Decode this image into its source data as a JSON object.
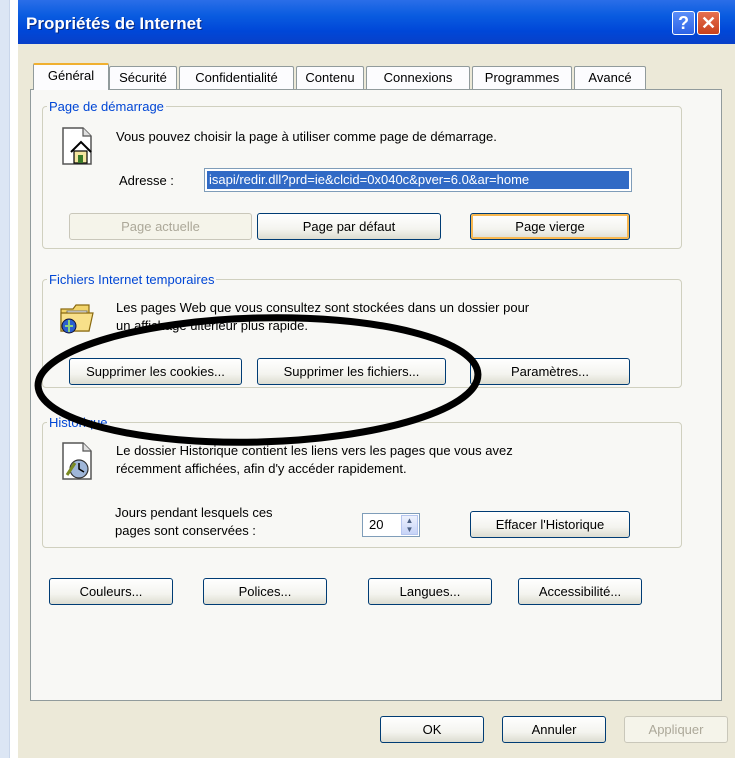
{
  "window": {
    "title": "Propriétés de Internet",
    "help_glyph": "?",
    "close_glyph": "✕"
  },
  "tabs": [
    {
      "label": "Général"
    },
    {
      "label": "Sécurité"
    },
    {
      "label": "Confidentialité"
    },
    {
      "label": "Contenu"
    },
    {
      "label": "Connexions"
    },
    {
      "label": "Programmes"
    },
    {
      "label": "Avancé"
    }
  ],
  "home": {
    "legend": "Page de démarrage",
    "description": "Vous pouvez choisir la page à utiliser comme page de démarrage.",
    "address_label": "Adresse :",
    "address_value": "isapi/redir.dll?prd=ie&clcid=0x040c&pver=6.0&ar=home",
    "btn_current": "Page actuelle",
    "btn_default": "Page par défaut",
    "btn_blank": "Page vierge"
  },
  "temp": {
    "legend": "Fichiers Internet temporaires",
    "line1": "Les pages Web que vous consultez sont stockées dans un dossier pour",
    "line2": "un affichage ultérieur plus rapide.",
    "btn_cookies": "Supprimer les cookies...",
    "btn_files": "Supprimer les fichiers...",
    "btn_settings": "Paramètres..."
  },
  "history": {
    "legend": "Historique",
    "line1": "Le dossier Historique contient les liens vers les pages que vous avez",
    "line2": "récemment affichées, afin d'y accéder rapidement.",
    "days_label1": "Jours pendant lesquels ces",
    "days_label2": "pages sont conservées :",
    "days_value": "20",
    "btn_clear": "Effacer l'Historique"
  },
  "bottom_buttons": {
    "colors": "Couleurs...",
    "fonts": "Polices...",
    "languages": "Langues...",
    "accessibility": "Accessibilité..."
  },
  "footer": {
    "ok": "OK",
    "cancel": "Annuler",
    "apply": "Appliquer"
  },
  "colors": {
    "title_blue": "#0a5ce0",
    "legend_blue": "#0046d5",
    "selection": "#316ac5",
    "annotation_ellipse": "#000000"
  }
}
